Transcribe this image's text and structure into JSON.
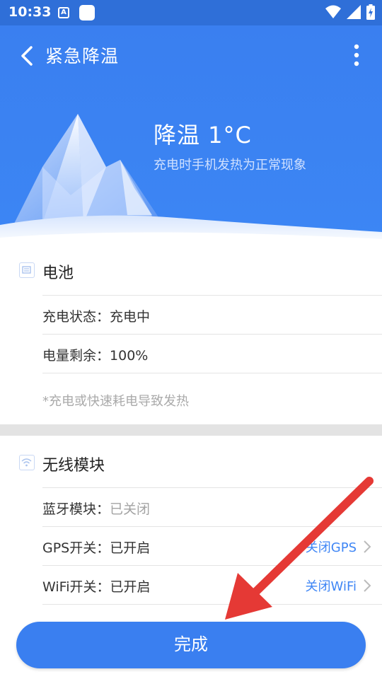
{
  "status_bar": {
    "time": "10:33",
    "notif_icon_letter": "A"
  },
  "toolbar": {
    "title": "紧急降温"
  },
  "hero": {
    "title": "降温 1°C",
    "subtitle": "充电时手机发热为正常现象"
  },
  "battery": {
    "title": "电池",
    "rows": [
      {
        "label": "充电状态：",
        "value": "充电中"
      },
      {
        "label": "电量剩余：",
        "value": "100%"
      }
    ],
    "note": "*充电或快速耗电导致发热"
  },
  "wireless": {
    "title": "无线模块",
    "rows": [
      {
        "label": "蓝牙模块：",
        "value": "已关闭"
      },
      {
        "label": "GPS开关：",
        "value": "已开启",
        "action": "关闭GPS"
      },
      {
        "label": "WiFi开关：",
        "value": "已开启",
        "action": "关闭WiFi"
      }
    ]
  },
  "done_button": {
    "label": "完成"
  },
  "colors": {
    "primary": "#3a7ff0",
    "statusbar": "#2f6fd8",
    "arrow": "#e53935",
    "link": "#3f86f5"
  }
}
